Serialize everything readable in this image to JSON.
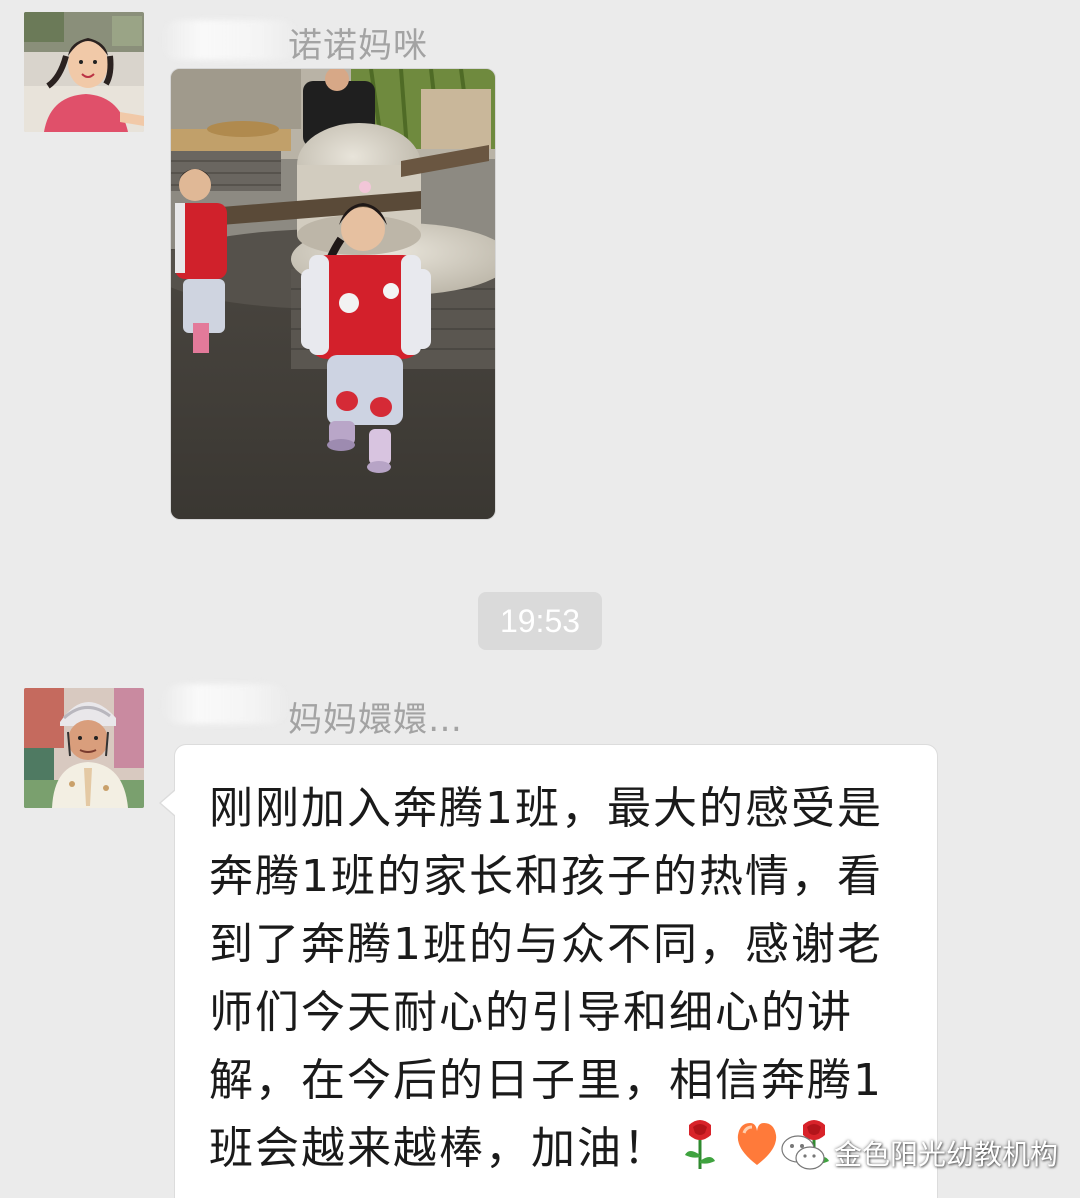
{
  "messages": [
    {
      "sender": "诺诺妈咪",
      "type": "image",
      "image_description_icon": "photo-children-at-stone-mill"
    },
    {
      "sender": "妈妈嬛嬛…",
      "type": "text",
      "text": "刚刚加入奔腾1班，最大的感受是奔腾1班的家长和孩子的热情，看到了奔腾1班的与众不同，感谢老师们今天耐心的引导和细心的讲解，在今后的日子里，相信奔腾1班会越来越棒，加油！",
      "emojis": [
        "rose-icon",
        "heart-icon",
        "rose-icon"
      ]
    }
  ],
  "timestamp": "19:53",
  "watermark": {
    "text": "金色阳光幼教机构",
    "icon": "wechat-icon"
  },
  "colors": {
    "background": "#ebebeb",
    "bubble": "#ffffff",
    "timestamp_bg": "#dadada",
    "sender_name": "#a3a3a3"
  }
}
